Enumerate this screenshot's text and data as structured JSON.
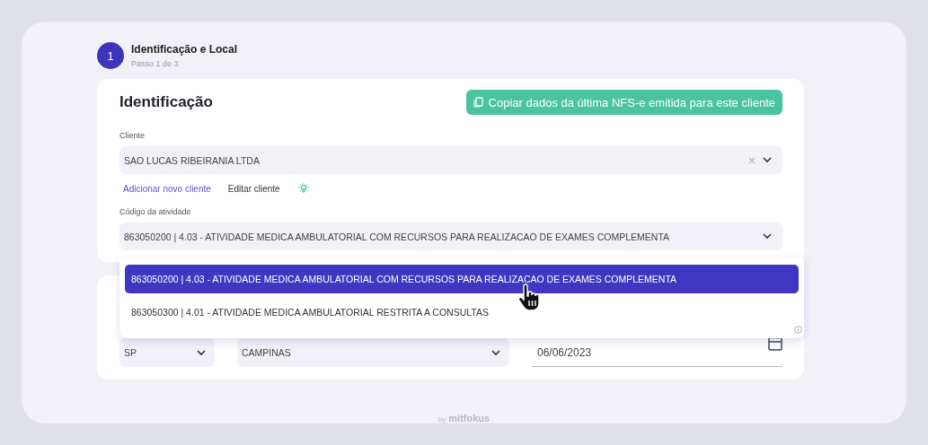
{
  "step": {
    "number": "1",
    "title": "Identificação e Local",
    "subtitle": "Passo 1 de 3"
  },
  "identification": {
    "title": "Identificação",
    "copy_button": "Copiar dados da última NFS-e emitida para este cliente",
    "client": {
      "label": "Cliente",
      "value": "SAO LUCAS RIBEIRANIA LTDA"
    },
    "links": [
      {
        "label": "Adicionar novo cliente",
        "kind": "primary"
      },
      {
        "label": "Editar cliente",
        "kind": "plain"
      }
    ],
    "activity": {
      "label": "Código da atividade",
      "value": "863050200 | 4.03 - ATIVIDADE MEDICA AMBULATORIAL COM RECURSOS PARA REALIZACAO DE EXAMES COMPLEMENTA",
      "expanded": true,
      "options": [
        {
          "label": "863050200 | 4.03 - ATIVIDADE MEDICA AMBULATORIAL COM RECURSOS PARA REALIZACAO DE EXAMES COMPLEMENTA",
          "selected": true
        },
        {
          "label": "863050300 | 4.01 - ATIVIDADE MEDICA AMBULATORIAL RESTRITA A CONSULTAS",
          "selected": false
        }
      ]
    }
  },
  "location": {
    "state": "SP",
    "city": "CAMPINAS",
    "date": "06/06/2023"
  },
  "footer": {
    "by": "by",
    "brand": "mitfokus"
  }
}
